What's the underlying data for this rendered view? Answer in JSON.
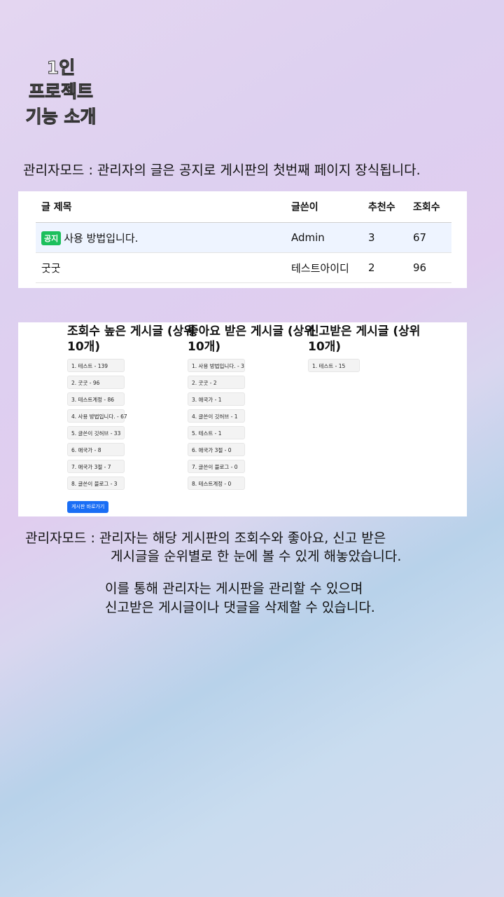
{
  "title": {
    "line1": "1인",
    "line2": "프로젝트",
    "line3": "기능 소개"
  },
  "section1": {
    "description": "관리자모드 : 관리자의 글은 공지로 게시판의 첫번째 페이지 장식됩니다.",
    "table": {
      "headers": [
        "글 제목",
        "글쓴이",
        "추천수",
        "조회수"
      ],
      "rows": [
        {
          "badge": "공지",
          "title": "사용 방법입니다.",
          "author": "Admin",
          "likes": "3",
          "views": "67"
        },
        {
          "badge": "",
          "title": "굿굿",
          "author": "테스트아이디",
          "likes": "2",
          "views": "96"
        }
      ]
    }
  },
  "section2": {
    "columns": [
      {
        "heading_l1": "조회수 높은 게시글 (상위",
        "heading_l2": "10개)",
        "items": [
          "1. 테스트 - 139",
          "2. 굿굿 - 96",
          "3. 테스트계정 - 86",
          "4. 사용 방법입니다. - 67",
          "5. 글쓴이 깃허브 - 33",
          "6. 애국가 - 8",
          "7. 애국가 3절 - 7",
          "8. 글쓴이 블로그 - 3"
        ]
      },
      {
        "heading_l1": "좋아요 받은 게시글 (상위",
        "heading_l2": "10개)",
        "items": [
          "1. 사용 방법입니다. - 3",
          "2. 굿굿 - 2",
          "3. 애국가 - 1",
          "4. 글쓴이 깃허브 - 1",
          "5. 테스트 - 1",
          "6. 애국가 3절 - 0",
          "7. 글쓴이 블로그 - 0",
          "8. 테스트계정 - 0"
        ]
      },
      {
        "heading_l1": "신고받은 게시글 (상위",
        "heading_l2": "10개)",
        "items": [
          "1. 테스트 - 15"
        ]
      }
    ],
    "button_label": "게시판 바로가기"
  },
  "section3": {
    "line1": "관리자모드 : 관리자는  해당 게시판의 조회수와 좋아요, 신고 받은",
    "line2": "게시글을 순위별로  한 눈에 볼 수 있게 해놓았습니다.",
    "line3": "이를 통해 관리자는 게시판을 관리할 수 있으며",
    "line4": "신고받은 게시글이나 댓글을 삭제할 수 있습니다."
  }
}
